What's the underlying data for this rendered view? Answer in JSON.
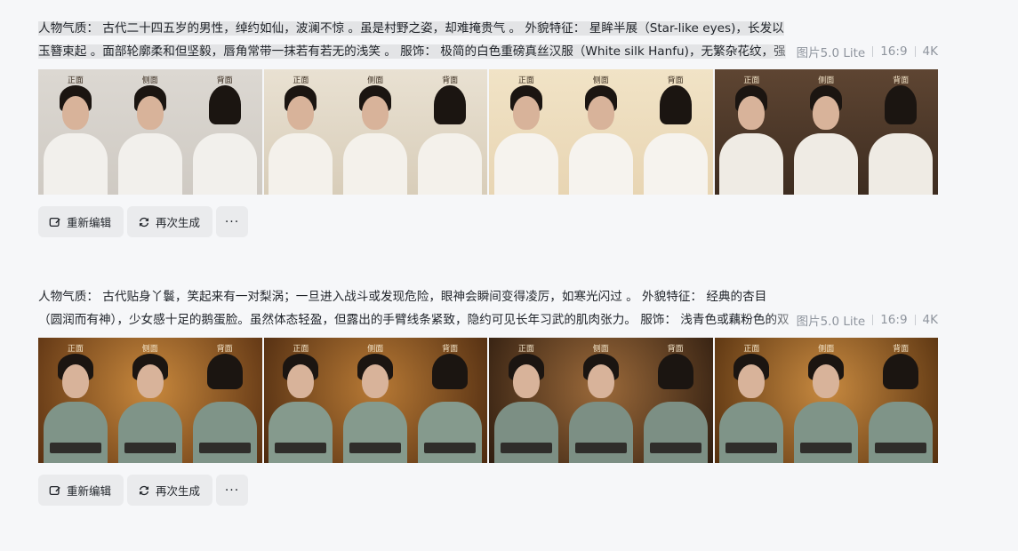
{
  "generations": [
    {
      "prompt": "人物气质： 古代二十四五岁的男性，绰约如仙，波澜不惊 。虽是村野之姿，却难掩贵气 。 外貌特征： 星眸半展（Star-like eyes)，长发以玉簪束起 。面部轮廓柔和但坚毅，唇角常带一抹若有若无的浅笑 。 服饰： 极简的白色重磅真丝汉服（White silk Hanfu)，无繁杂花纹，强调剪裁与质感。 提示",
      "model": "图片5.0 Lite",
      "ratio": "16:9",
      "resolution": "4K",
      "images": [
        {
          "labels": [
            "正面",
            "侧面",
            "背面"
          ]
        },
        {
          "labels": [
            "正面",
            "侧面",
            "背面"
          ]
        },
        {
          "labels": [
            "正面",
            "侧面",
            "背面"
          ]
        },
        {
          "labels": [
            "正面",
            "侧面",
            "背面"
          ]
        }
      ],
      "actions": {
        "edit": "重新编辑",
        "regenerate": "再次生成",
        "more": "···"
      }
    },
    {
      "prompt": "人物气质： 古代贴身丫鬟，笑起来有一对梨涡；一旦进入战斗或发现危险，眼神会瞬间变得凌厉，如寒光闪过 。 外貌特征： 经典的杏目 （圆润而有神），少女感十足的鹅蛋脸。虽然体态轻盈，但露出的手臂线条紧致，隐约可见长年习武的肌肉张力。 服饰： 浅青色或藕粉色的双襟短衫，腰间束有黑",
      "model": "图片5.0 Lite",
      "ratio": "16:9",
      "resolution": "4K",
      "images": [
        {
          "labels": [
            "正面",
            "侧面",
            "背面"
          ]
        },
        {
          "labels": [
            "正面",
            "侧面",
            "背面"
          ]
        },
        {
          "labels": [
            "正面",
            "侧面",
            "背面"
          ]
        },
        {
          "labels": [
            "正面",
            "侧面",
            "背面"
          ]
        }
      ],
      "actions": {
        "edit": "重新编辑",
        "regenerate": "再次生成",
        "more": "···"
      }
    }
  ],
  "colors": {
    "bg": "#f6f7f9",
    "button_bg": "#eaebed",
    "meta_text": "#8f959e",
    "male_robe": "#f2f0ec",
    "female_robe": "#7f9488",
    "sash": "#2f2d2a"
  },
  "icons": {
    "edit": "edit-icon",
    "regenerate": "refresh-icon",
    "more": "more-icon"
  }
}
